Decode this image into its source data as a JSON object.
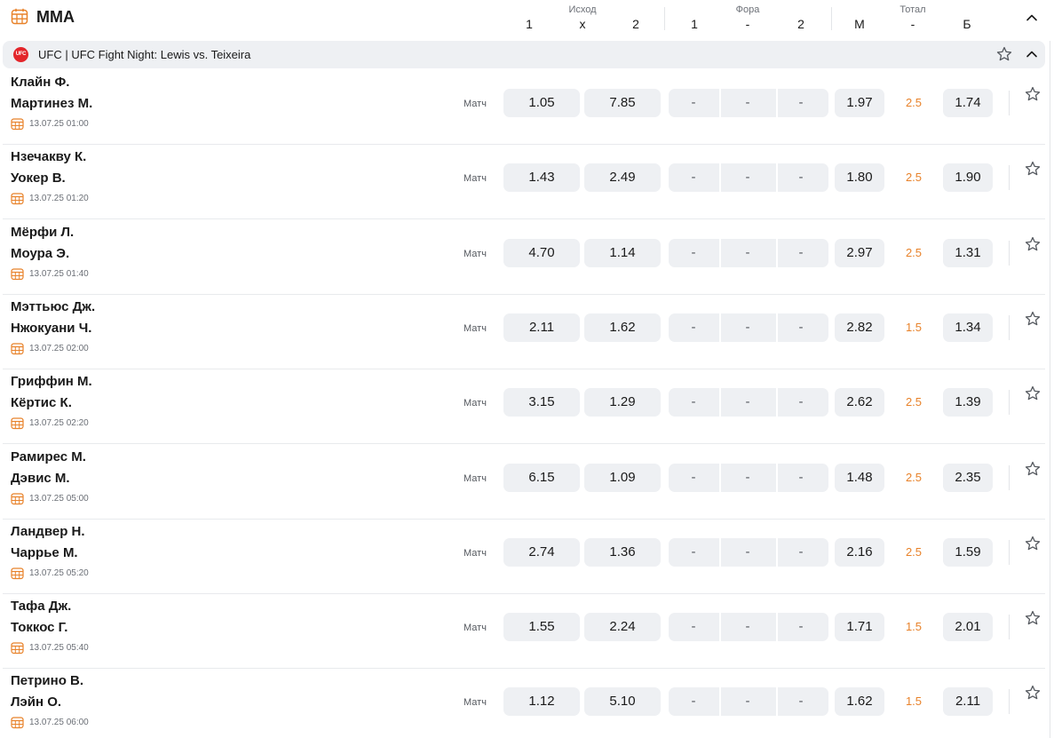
{
  "header": {
    "title": "MMA",
    "icon": "calendar-grid-icon",
    "groups": [
      {
        "title": "Исход",
        "cols": [
          "1",
          "х",
          "2"
        ]
      },
      {
        "title": "Фора",
        "cols": [
          "1",
          "-",
          "2"
        ]
      },
      {
        "title": "Тотал",
        "cols": [
          "М",
          "-",
          "Б"
        ]
      }
    ]
  },
  "league": {
    "logo_text": "UFC",
    "name": "UFC | UFC Fight Night: Lewis vs. Teixeira"
  },
  "colors": {
    "accent_orange": "#e8822a",
    "odds_bg": "#eef0f3",
    "ufc_red": "#e3262b"
  },
  "matches": [
    {
      "team1": "Клайн Ф.",
      "team2": "Мартинез М.",
      "time": "13.07.25 01:00",
      "market": "Матч",
      "odds": [
        "1.05",
        "7.85"
      ],
      "fora": [
        "-",
        "-",
        "-"
      ],
      "total": [
        "1.97",
        "2.5",
        "1.74"
      ]
    },
    {
      "team1": "Нзечакву К.",
      "team2": "Уокер В.",
      "time": "13.07.25 01:20",
      "market": "Матч",
      "odds": [
        "1.43",
        "2.49"
      ],
      "fora": [
        "-",
        "-",
        "-"
      ],
      "total": [
        "1.80",
        "2.5",
        "1.90"
      ]
    },
    {
      "team1": "Мёрфи Л.",
      "team2": "Моура Э.",
      "time": "13.07.25 01:40",
      "market": "Матч",
      "odds": [
        "4.70",
        "1.14"
      ],
      "fora": [
        "-",
        "-",
        "-"
      ],
      "total": [
        "2.97",
        "2.5",
        "1.31"
      ]
    },
    {
      "team1": "Мэттьюс Дж.",
      "team2": "Нжокуани Ч.",
      "time": "13.07.25 02:00",
      "market": "Матч",
      "odds": [
        "2.11",
        "1.62"
      ],
      "fora": [
        "-",
        "-",
        "-"
      ],
      "total": [
        "2.82",
        "1.5",
        "1.34"
      ]
    },
    {
      "team1": "Гриффин М.",
      "team2": "Кёртис К.",
      "time": "13.07.25 02:20",
      "market": "Матч",
      "odds": [
        "3.15",
        "1.29"
      ],
      "fora": [
        "-",
        "-",
        "-"
      ],
      "total": [
        "2.62",
        "2.5",
        "1.39"
      ]
    },
    {
      "team1": "Рамирес М.",
      "team2": "Дэвис М.",
      "time": "13.07.25 05:00",
      "market": "Матч",
      "odds": [
        "6.15",
        "1.09"
      ],
      "fora": [
        "-",
        "-",
        "-"
      ],
      "total": [
        "1.48",
        "2.5",
        "2.35"
      ]
    },
    {
      "team1": "Ландвер Н.",
      "team2": "Чаррье М.",
      "time": "13.07.25 05:20",
      "market": "Матч",
      "odds": [
        "2.74",
        "1.36"
      ],
      "fora": [
        "-",
        "-",
        "-"
      ],
      "total": [
        "2.16",
        "2.5",
        "1.59"
      ]
    },
    {
      "team1": "Тафа Дж.",
      "team2": "Токкос Г.",
      "time": "13.07.25 05:40",
      "market": "Матч",
      "odds": [
        "1.55",
        "2.24"
      ],
      "fora": [
        "-",
        "-",
        "-"
      ],
      "total": [
        "1.71",
        "1.5",
        "2.01"
      ]
    },
    {
      "team1": "Петрино В.",
      "team2": "Лэйн О.",
      "time": "13.07.25 06:00",
      "market": "Матч",
      "odds": [
        "1.12",
        "5.10"
      ],
      "fora": [
        "-",
        "-",
        "-"
      ],
      "total": [
        "1.62",
        "1.5",
        "2.11"
      ]
    }
  ]
}
